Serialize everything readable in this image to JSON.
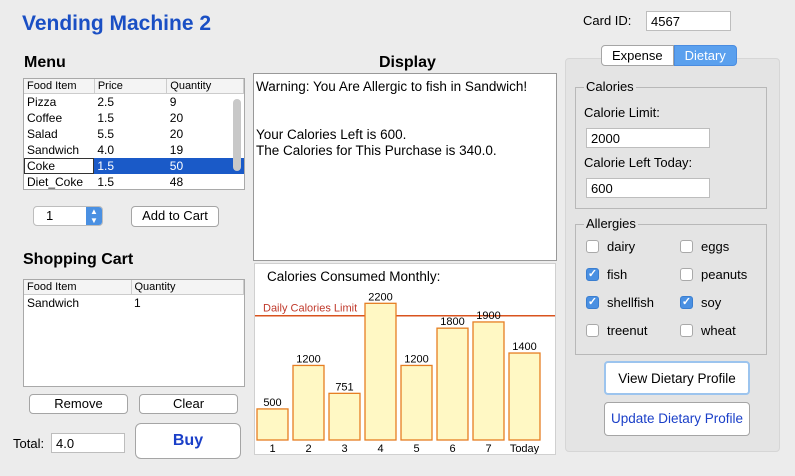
{
  "app": {
    "title": "Vending Machine 2"
  },
  "card": {
    "label": "Card ID:",
    "value": "4567"
  },
  "menu": {
    "heading": "Menu",
    "columns": [
      "Food Item",
      "Price",
      "Quantity"
    ],
    "rows": [
      [
        "Pizza",
        "2.5",
        "9"
      ],
      [
        "Coffee",
        "1.5",
        "20"
      ],
      [
        "Salad",
        "5.5",
        "20"
      ],
      [
        "Sandwich",
        "4.0",
        "19"
      ],
      [
        "Coke",
        "1.5",
        "50"
      ],
      [
        "Diet_Coke",
        "1.5",
        "48"
      ]
    ],
    "selected_index": 4,
    "qty_value": "1",
    "add_label": "Add to Cart"
  },
  "cart": {
    "heading": "Shopping Cart",
    "columns": [
      "Food Item",
      "Quantity"
    ],
    "rows": [
      [
        "Sandwich",
        "1"
      ]
    ],
    "remove_label": "Remove",
    "clear_label": "Clear",
    "total_label": "Total:",
    "total_value": "4.0",
    "buy_label": "Buy"
  },
  "display": {
    "heading": "Display",
    "line1": "Warning: You Are Allergic to fish in Sandwich!",
    "line2": "Your Calories Left is 600.",
    "line3": "The Calories for This Purchase is 340.0."
  },
  "chart_data": {
    "type": "bar",
    "title": "Calories Consumed Monthly:",
    "categories": [
      "1",
      "2",
      "3",
      "4",
      "5",
      "6",
      "7",
      "Today"
    ],
    "values": [
      500,
      1200,
      751,
      2200,
      1200,
      1800,
      1900,
      1400
    ],
    "reference_line": {
      "label": "Daily Calories Limit",
      "value": 2000,
      "color": "#d9531e"
    },
    "bar_fill": "#fff8c4",
    "bar_stroke": "#e67e22",
    "ylim": [
      0,
      2350
    ]
  },
  "tabs": [
    {
      "label": "Expense",
      "active": false
    },
    {
      "label": "Dietary",
      "active": true
    }
  ],
  "calories": {
    "group_label": "Calories",
    "limit_label": "Calorie Limit:",
    "limit_value": "2000",
    "left_label": "Calorie Left Today:",
    "left_value": "600"
  },
  "allergies": {
    "group_label": "Allergies",
    "items": [
      {
        "label": "dairy",
        "checked": false
      },
      {
        "label": "eggs",
        "checked": false
      },
      {
        "label": "fish",
        "checked": true
      },
      {
        "label": "peanuts",
        "checked": false
      },
      {
        "label": "shellfish",
        "checked": true
      },
      {
        "label": "soy",
        "checked": true
      },
      {
        "label": "treenut",
        "checked": false
      },
      {
        "label": "wheat",
        "checked": false
      }
    ]
  },
  "buttons": {
    "view_profile": "View Dietary Profile",
    "update_profile": "Update Dietary Profile"
  },
  "colors": {
    "title": "#1a4fc4",
    "buy": "#1a3fc8",
    "selection": "#1a5ac8",
    "tab_active": "#5aa0ee"
  }
}
